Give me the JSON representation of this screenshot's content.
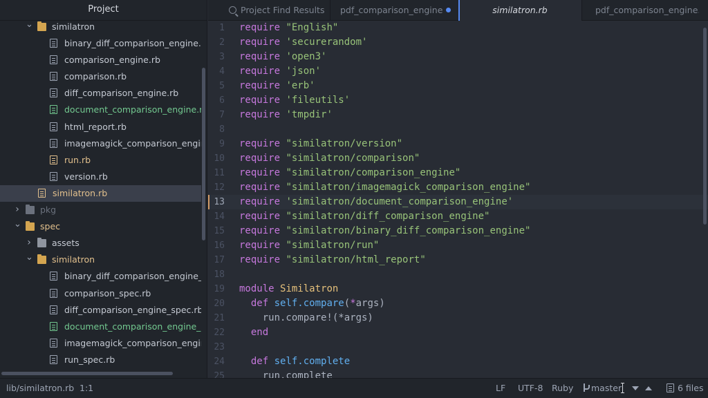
{
  "sidebar": {
    "title": "Project",
    "tree": [
      {
        "label": "similatron",
        "kind": "folder",
        "expanded": true,
        "depth": 1,
        "status": "normal"
      },
      {
        "label": "binary_diff_comparison_engine.rb",
        "kind": "file",
        "depth": 2,
        "status": "normal"
      },
      {
        "label": "comparison_engine.rb",
        "kind": "file",
        "depth": 2,
        "status": "normal"
      },
      {
        "label": "comparison.rb",
        "kind": "file",
        "depth": 2,
        "status": "normal"
      },
      {
        "label": "diff_comparison_engine.rb",
        "kind": "file",
        "depth": 2,
        "status": "normal"
      },
      {
        "label": "document_comparison_engine.rb",
        "kind": "file",
        "depth": 2,
        "status": "added"
      },
      {
        "label": "html_report.rb",
        "kind": "file",
        "depth": 2,
        "status": "normal"
      },
      {
        "label": "imagemagick_comparison_engine.rb",
        "kind": "file",
        "depth": 2,
        "status": "normal"
      },
      {
        "label": "run.rb",
        "kind": "file",
        "depth": 2,
        "status": "modified"
      },
      {
        "label": "version.rb",
        "kind": "file",
        "depth": 2,
        "status": "normal"
      },
      {
        "label": "similatron.rb",
        "kind": "file",
        "depth": 1,
        "status": "modified",
        "selected": true
      },
      {
        "label": "pkg",
        "kind": "folder",
        "expanded": false,
        "depth": 0,
        "status": "ignored"
      },
      {
        "label": "spec",
        "kind": "folder",
        "expanded": true,
        "depth": 0,
        "status": "modified"
      },
      {
        "label": "assets",
        "kind": "folder",
        "expanded": false,
        "depth": 1,
        "status": "normal"
      },
      {
        "label": "similatron",
        "kind": "folder",
        "expanded": true,
        "depth": 1,
        "status": "modified"
      },
      {
        "label": "binary_diff_comparison_engine_spec.rb",
        "kind": "file",
        "depth": 2,
        "status": "normal"
      },
      {
        "label": "comparison_spec.rb",
        "kind": "file",
        "depth": 2,
        "status": "normal"
      },
      {
        "label": "diff_comparison_engine_spec.rb",
        "kind": "file",
        "depth": 2,
        "status": "normal"
      },
      {
        "label": "document_comparison_engine_spec.rb",
        "kind": "file",
        "depth": 2,
        "status": "added"
      },
      {
        "label": "imagemagick_comparison_engine_spec.rb",
        "kind": "file",
        "depth": 2,
        "status": "normal"
      },
      {
        "label": "run_spec.rb",
        "kind": "file",
        "depth": 2,
        "status": "normal"
      }
    ]
  },
  "tabs": [
    {
      "label": "Project Find Results",
      "icon": "search-icon",
      "active": false,
      "modified": false
    },
    {
      "label": "pdf_comparison_engine_spec.rb",
      "active": false,
      "modified": true
    },
    {
      "label": "similatron.rb",
      "active": true,
      "modified": false
    },
    {
      "label": "pdf_comparison_engine.rb",
      "active": false,
      "modified": false
    }
  ],
  "editor": {
    "cursor_line": 13,
    "lines": [
      {
        "n": "1",
        "tokens": [
          [
            "kw",
            "require"
          ],
          [
            "plain",
            " "
          ],
          [
            "str",
            "\"English\""
          ]
        ]
      },
      {
        "n": "2",
        "tokens": [
          [
            "kw",
            "require"
          ],
          [
            "plain",
            " "
          ],
          [
            "str",
            "'securerandom'"
          ]
        ]
      },
      {
        "n": "3",
        "tokens": [
          [
            "kw",
            "require"
          ],
          [
            "plain",
            " "
          ],
          [
            "str",
            "'open3'"
          ]
        ]
      },
      {
        "n": "4",
        "tokens": [
          [
            "kw",
            "require"
          ],
          [
            "plain",
            " "
          ],
          [
            "str",
            "'json'"
          ]
        ]
      },
      {
        "n": "5",
        "tokens": [
          [
            "kw",
            "require"
          ],
          [
            "plain",
            " "
          ],
          [
            "str",
            "'erb'"
          ]
        ]
      },
      {
        "n": "6",
        "tokens": [
          [
            "kw",
            "require"
          ],
          [
            "plain",
            " "
          ],
          [
            "str",
            "'fileutils'"
          ]
        ]
      },
      {
        "n": "7",
        "tokens": [
          [
            "kw",
            "require"
          ],
          [
            "plain",
            " "
          ],
          [
            "str",
            "'tmpdir'"
          ]
        ]
      },
      {
        "n": "8",
        "tokens": []
      },
      {
        "n": "9",
        "tokens": [
          [
            "kw",
            "require"
          ],
          [
            "plain",
            " "
          ],
          [
            "str",
            "\"similatron/version\""
          ]
        ]
      },
      {
        "n": "10",
        "tokens": [
          [
            "kw",
            "require"
          ],
          [
            "plain",
            " "
          ],
          [
            "str",
            "\"similatron/comparison\""
          ]
        ]
      },
      {
        "n": "11",
        "tokens": [
          [
            "kw",
            "require"
          ],
          [
            "plain",
            " "
          ],
          [
            "str",
            "\"similatron/comparison_engine\""
          ]
        ]
      },
      {
        "n": "12",
        "tokens": [
          [
            "kw",
            "require"
          ],
          [
            "plain",
            " "
          ],
          [
            "str",
            "\"similatron/imagemagick_comparison_engine\""
          ]
        ]
      },
      {
        "n": "13",
        "tokens": [
          [
            "kw",
            "require"
          ],
          [
            "plain",
            " "
          ],
          [
            "str",
            "'similatron/document_comparison_engine'"
          ]
        ]
      },
      {
        "n": "14",
        "tokens": [
          [
            "kw",
            "require"
          ],
          [
            "plain",
            " "
          ],
          [
            "str",
            "\"similatron/diff_comparison_engine\""
          ]
        ]
      },
      {
        "n": "15",
        "tokens": [
          [
            "kw",
            "require"
          ],
          [
            "plain",
            " "
          ],
          [
            "str",
            "\"similatron/binary_diff_comparison_engine\""
          ]
        ]
      },
      {
        "n": "16",
        "tokens": [
          [
            "kw",
            "require"
          ],
          [
            "plain",
            " "
          ],
          [
            "str",
            "\"similatron/run\""
          ]
        ]
      },
      {
        "n": "17",
        "tokens": [
          [
            "kw",
            "require"
          ],
          [
            "plain",
            " "
          ],
          [
            "str",
            "\"similatron/html_report\""
          ]
        ]
      },
      {
        "n": "18",
        "tokens": []
      },
      {
        "n": "19",
        "tokens": [
          [
            "kw",
            "module"
          ],
          [
            "plain",
            " "
          ],
          [
            "cls",
            "Similatron"
          ]
        ]
      },
      {
        "n": "20",
        "tokens": [
          [
            "plain",
            "  "
          ],
          [
            "kw",
            "def"
          ],
          [
            "plain",
            " "
          ],
          [
            "fn",
            "self.compare"
          ],
          [
            "plain",
            "("
          ],
          [
            "kw",
            "*"
          ],
          [
            "plain",
            "args)"
          ]
        ]
      },
      {
        "n": "21",
        "tokens": [
          [
            "plain",
            "    run.compare!(*args)"
          ]
        ]
      },
      {
        "n": "22",
        "tokens": [
          [
            "plain",
            "  "
          ],
          [
            "kw",
            "end"
          ]
        ]
      },
      {
        "n": "23",
        "tokens": []
      },
      {
        "n": "24",
        "tokens": [
          [
            "plain",
            "  "
          ],
          [
            "kw",
            "def"
          ],
          [
            "plain",
            " "
          ],
          [
            "fn",
            "self.complete"
          ]
        ]
      },
      {
        "n": "25",
        "tokens": [
          [
            "plain",
            "    run.complete"
          ]
        ]
      }
    ]
  },
  "status": {
    "file_path": "lib/similatron.rb",
    "cursor_position": "1:1",
    "line_ending": "LF",
    "encoding": "UTF-8",
    "grammar": "Ruby",
    "branch": "master",
    "changed_files": "6 files"
  },
  "colors": {
    "accent": "#568af2",
    "added": "#73c990",
    "modified": "#e2c08d",
    "keyword": "#c678dd",
    "string": "#98c379",
    "constant": "#e5c07b",
    "function": "#61afef"
  }
}
